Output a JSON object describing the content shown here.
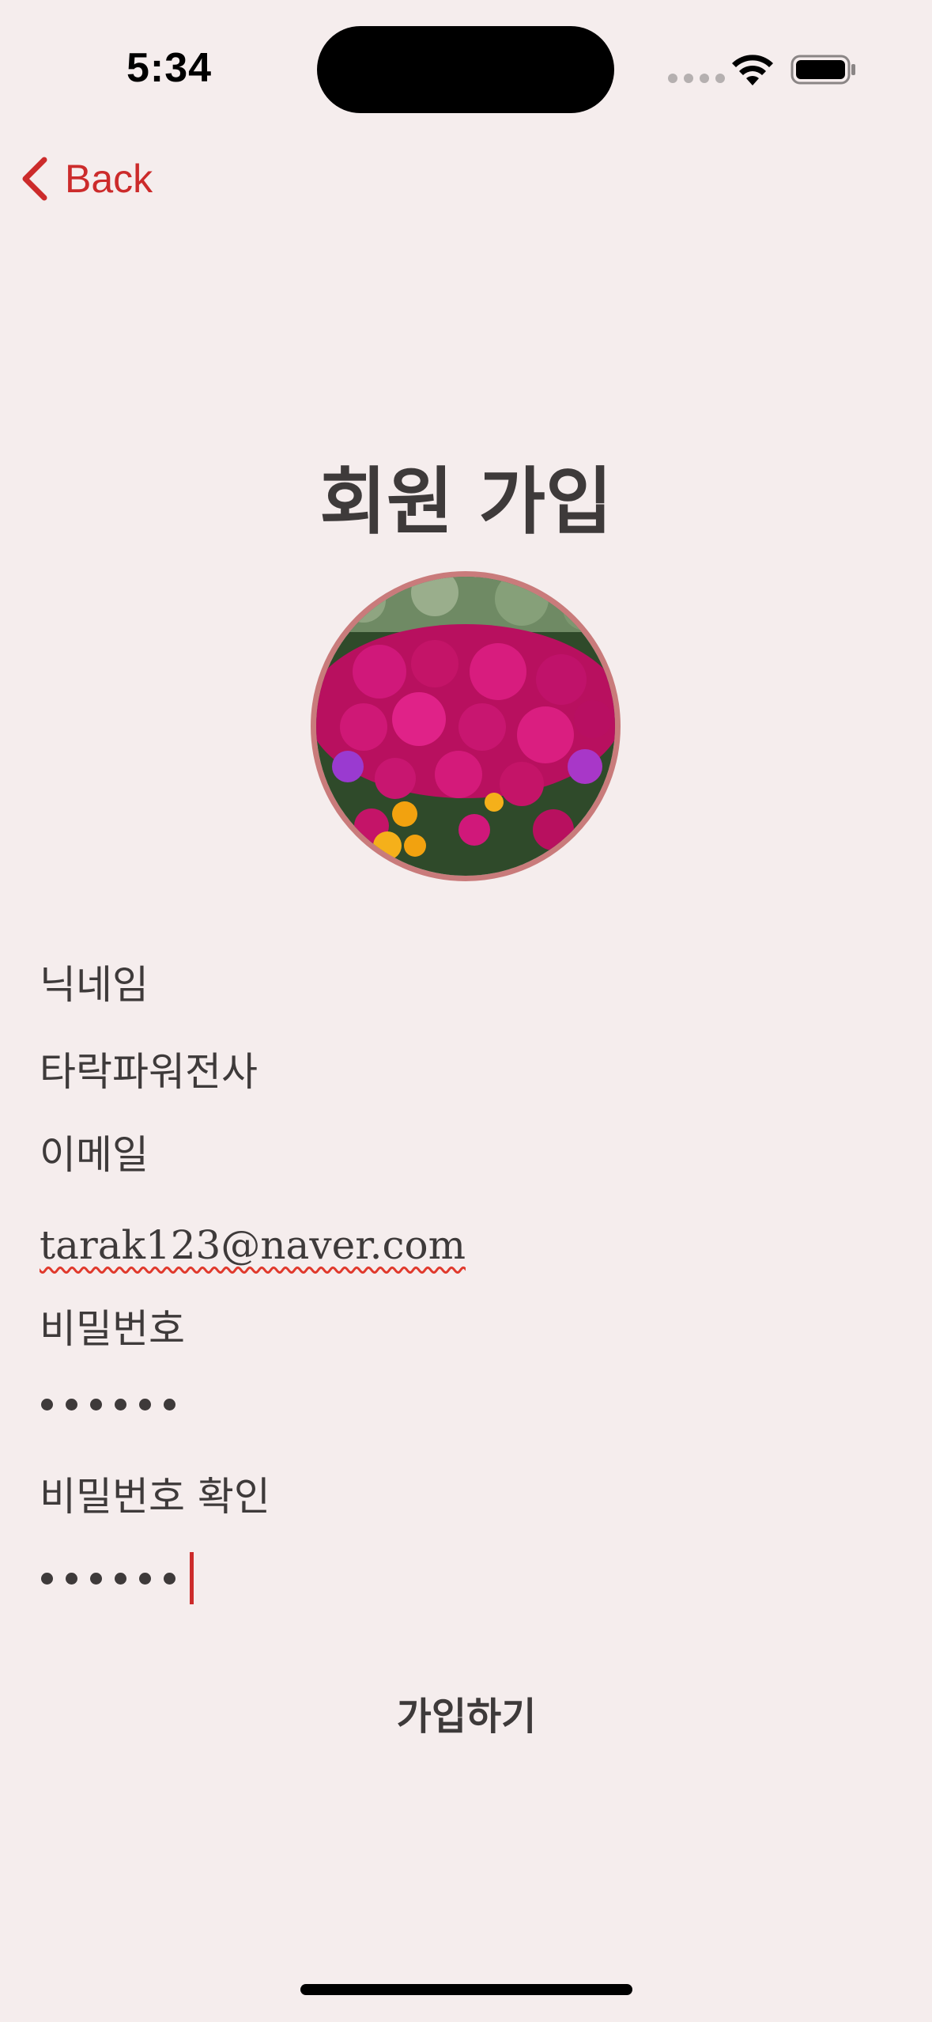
{
  "status_bar": {
    "time": "5:34",
    "icons": [
      "signal-icon",
      "wifi-icon",
      "battery-icon"
    ]
  },
  "nav": {
    "back_label": "Back",
    "accent_color": "#cc2b2b"
  },
  "page": {
    "title": "회원 가입",
    "background_color": "#f5eded"
  },
  "avatar": {
    "image": "flower-bed-photo",
    "border_color": "#c97b7b"
  },
  "form": {
    "nickname": {
      "label": "닉네임",
      "value": "타락파워전사"
    },
    "email": {
      "label": "이메일",
      "value": "tarak123@naver.com"
    },
    "password": {
      "label": "비밀번호",
      "masked_length": 6
    },
    "password_confirm": {
      "label": "비밀번호 확인",
      "masked_length": 6
    },
    "submit_label": "가입하기"
  }
}
